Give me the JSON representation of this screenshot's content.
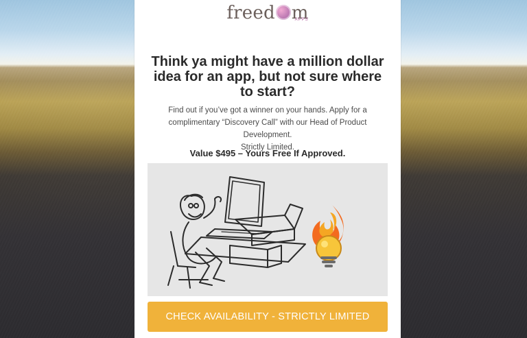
{
  "brand": {
    "logo_word_left": "freed",
    "logo_word_right": "m",
    "logo_sub": "APPS"
  },
  "headline": {
    "line1": "Think ya might have a million dollar",
    "line2": "idea for an app, but not sure where",
    "line3": "to start?"
  },
  "subcopy": {
    "line1": "Find out if you’ve got a winner on your hands. Apply for a",
    "line2": "complimentary “Discovery Call” with our Head of Product Development.",
    "line3": "Strictly Limited."
  },
  "value_line": "Value $495 – Yours Free If Approved.",
  "cta": {
    "label": "CHECK AVAILABILITY - STRICTLY LIMITED"
  },
  "illustration": {
    "icons": [
      "computer-user-illustration",
      "lightbulb-flame-icon"
    ]
  },
  "colors": {
    "cta": "#f0b23a",
    "panel": "#ffffff",
    "illustration_bg": "#e6e6e6",
    "logo_text": "#6b5f5b",
    "logo_accent": "#c07db5"
  }
}
